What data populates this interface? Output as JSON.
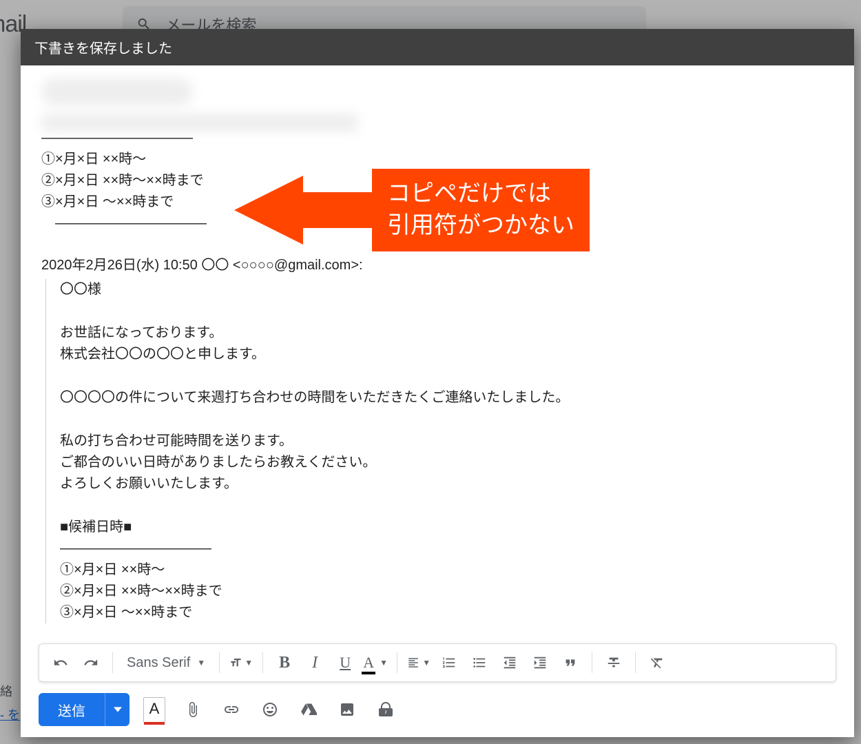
{
  "topbar": {
    "logo_text": "mail",
    "search_placeholder": "メールを検索"
  },
  "left_fragments": {
    "grey_text": "絡",
    "link_text": "- を"
  },
  "compose": {
    "header_status": "下書きを保存しました",
    "body": {
      "sep_top": "―――――――――――",
      "line1": "①×月×日 ××時～",
      "line2": "②×月×日 ××時～××時まで",
      "line3": "③×月×日 ～××時まで",
      "sep_bottom": "　―――――――――――",
      "quote_attrib": "2020年2月26日(水) 10:50 〇〇 <○○○○@gmail.com>:",
      "quoted": {
        "l1": "〇〇様",
        "l2": "お世話になっております。",
        "l3": "株式会社〇〇の〇〇と申します。",
        "l4": "〇〇〇〇の件について来週打ち合わせの時間をいただきたくご連絡いたしました。",
        "l5": "私の打ち合わせ可能時間を送ります。",
        "l6": "ご都合のいい日時がありましたらお教えください。",
        "l7": "よろしくお願いいたします。",
        "l8": "■候補日時■",
        "l9": "―――――――――――",
        "l10": "①×月×日 ××時～",
        "l11": "②×月×日 ××時～××時まで",
        "l12": "③×月×日 ～××時まで"
      }
    },
    "callout": "コピペだけでは\n引用符がつかない",
    "format_toolbar": {
      "font_name": "Sans Serif"
    },
    "actions": {
      "send_label": "送信"
    }
  }
}
